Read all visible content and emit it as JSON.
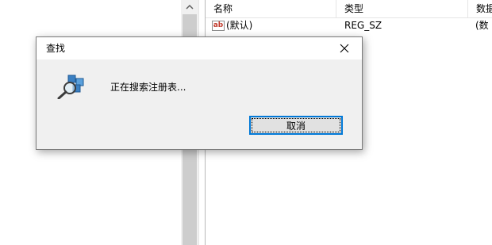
{
  "list": {
    "columns": {
      "name": "名称",
      "type": "类型",
      "data": "数据"
    },
    "rows": [
      {
        "icon": "ab",
        "name": "(默认)",
        "type": "REG_SZ",
        "data": "(数"
      }
    ]
  },
  "dialog": {
    "title": "查找",
    "message": "正在搜索注册表...",
    "cancel_label": "取消",
    "icon": "search-registry-icon",
    "close_icon": "close-icon"
  },
  "colors": {
    "accent": "#0078d7",
    "dialog_bg": "#f0f0f0",
    "scroll_thumb": "#cdcdcd"
  }
}
